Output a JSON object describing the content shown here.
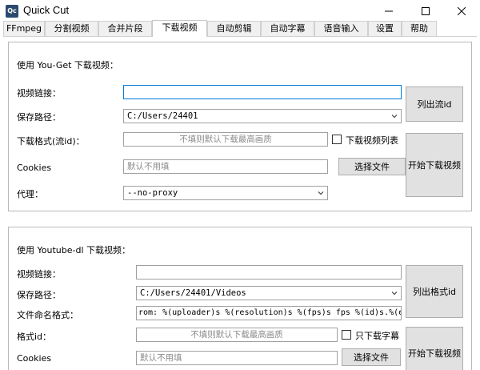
{
  "window": {
    "icon_text": "Qc",
    "title": "Quick Cut"
  },
  "tabs": [
    {
      "label": "FFmpeg"
    },
    {
      "label": "分割视频"
    },
    {
      "label": "合并片段"
    },
    {
      "label": "下载视频"
    },
    {
      "label": "自动剪辑"
    },
    {
      "label": "自动字幕"
    },
    {
      "label": "语音输入"
    },
    {
      "label": "设置"
    },
    {
      "label": "帮助"
    }
  ],
  "active_tab": "下载视频",
  "you_get": {
    "heading": "使用 You-Get 下载视频：",
    "url_label": "视频链接：",
    "url_value": "",
    "save_path_label": "保存路径：",
    "save_path_value": "C:/Users/24401",
    "format_label": "下载格式(流id)：",
    "format_placeholder": "不填则默认下载最高画质",
    "playlist_label": "下载视频列表",
    "cookies_label": "Cookies",
    "cookies_placeholder": "默认不用填",
    "choose_file_button": "选择文件",
    "proxy_label": "代理：",
    "proxy_value": "--no-proxy",
    "list_streams_button": "列出流id",
    "start_download_button": "开始下载视频"
  },
  "youtube_dl": {
    "heading": "使用 Youtube-dl 下载视频：",
    "url_label": "视频链接：",
    "url_value": "",
    "save_path_label": "保存路径：",
    "save_path_value": "C:/Users/24401/Videos",
    "filename_label": "文件命名格式：",
    "filename_value": "rom: %(uploader)s %(resolution)s %(fps)s fps %(id)s.%(ext)s",
    "format_id_label": "格式id：",
    "format_id_placeholder": "不填则默认下载最高画质",
    "subs_only_label": "只下载字幕",
    "cookies_label": "Cookies",
    "cookies_placeholder": "默认不用填",
    "choose_file_button": "选择文件",
    "list_formats_button": "列出格式id",
    "start_download_button": "开始下载视频"
  }
}
